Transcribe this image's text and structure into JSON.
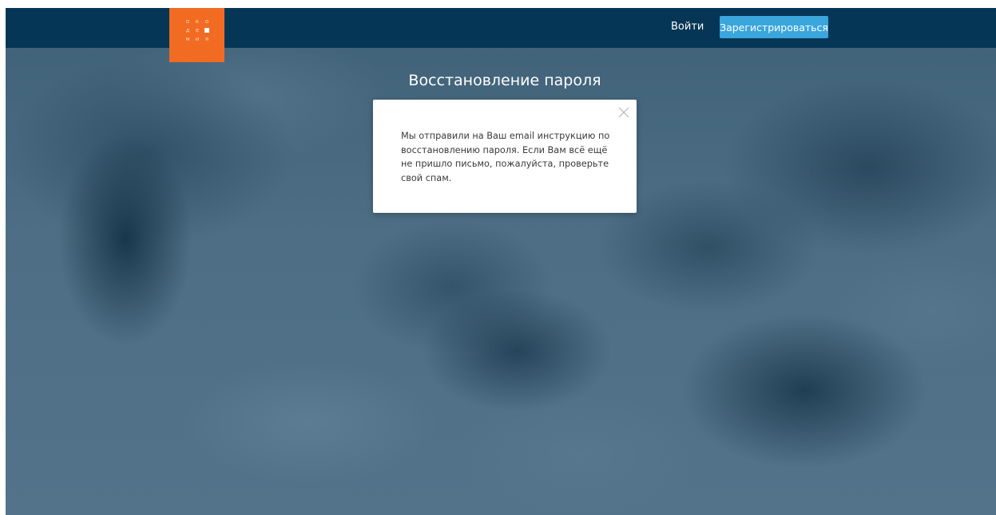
{
  "header": {
    "logo": {
      "letters": [
        "о",
        "к",
        "о",
        "д",
        "е",
        "■",
        "м",
        "и",
        "я"
      ],
      "color": "#f26b22"
    },
    "login_label": "Войти",
    "register_label": "Зарегистрироваться",
    "bar_color": "#063656",
    "accent_color": "#3aa6dc"
  },
  "main": {
    "title": "Восстановление пароля"
  },
  "modal": {
    "message": "Мы отправили на Ваш email инструкцию по восстановлению пароля. Если Вам всё ещё не пришло письмо, пожалуйста, проверьте свой спам.",
    "close_icon": "close-icon"
  }
}
